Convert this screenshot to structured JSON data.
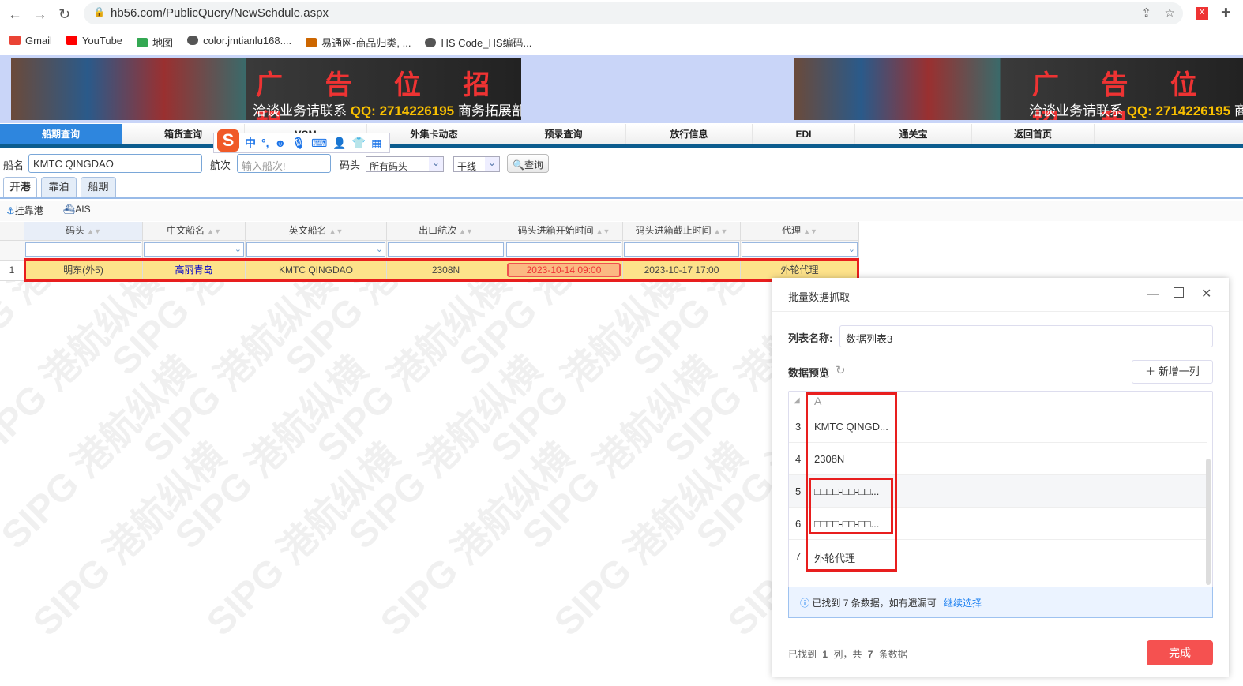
{
  "browser": {
    "url": "hb56.com/PublicQuery/NewSchdule.aspx",
    "bookmarks": [
      "Gmail",
      "YouTube",
      "地图",
      "color.jmtianlu168....",
      "易通网-商品归类, ...",
      "HS Code_HS编码..."
    ]
  },
  "banner": {
    "title": "广 告 位 招 租",
    "contact": "洽谈业务请联系",
    "qq": "QQ: 2714226195",
    "dept": "商务拓展部"
  },
  "menu": [
    "船期查询",
    "箱货查询",
    "VGM",
    "外集卡动态",
    "预录查询",
    "放行信息",
    "EDI",
    "通关宝",
    "返回首页"
  ],
  "ime": {
    "logo": "S",
    "mode": "中",
    "punct": "°,"
  },
  "search": {
    "ship_label": "船名",
    "ship_value": "KMTC QINGDAO",
    "voyage_label": "航次",
    "voyage_placeholder": "输入船次!",
    "terminal_label": "码头",
    "terminal_value": "所有码头",
    "line_value": "干线",
    "query_button": "查询"
  },
  "tabs": [
    "开港",
    "靠泊",
    "船期"
  ],
  "toolbar": {
    "port": "挂靠港",
    "ais": "AIS"
  },
  "grid": {
    "columns": [
      "码头",
      "中文船名",
      "英文船名",
      "出口航次",
      "码头进箱开始时间",
      "码头进箱截止时间",
      "代理"
    ],
    "rows": [
      {
        "no": "1",
        "cells": [
          "明东(外5)",
          "高丽青岛",
          "KMTC QINGDAO",
          "2308N",
          "2023-10-14 09:00",
          "2023-10-17 17:00",
          "外轮代理"
        ]
      }
    ]
  },
  "watermark": "SIPG 港航纵横",
  "dialog": {
    "title": "批量数据抓取",
    "list_name_label": "列表名称:",
    "list_name_value": "数据列表3",
    "preview_label": "数据预览",
    "add_column": "新增一列",
    "column_header": "A",
    "preview_rows": [
      {
        "n": "3",
        "v": "KMTC QINGD..."
      },
      {
        "n": "4",
        "v": "2308N"
      },
      {
        "n": "5",
        "v": "□□□□-□□-□□..."
      },
      {
        "n": "6",
        "v": "□□□□-□□-□□..."
      },
      {
        "n": "7",
        "v": "外轮代理"
      }
    ],
    "info_text": "已找到 7 条数据，如有遗漏可",
    "info_link": "继续选择",
    "summary": {
      "a": "已找到",
      "cols": "1",
      "b": "列，共",
      "rows": "7",
      "c": "条数据"
    },
    "done": "完成"
  }
}
